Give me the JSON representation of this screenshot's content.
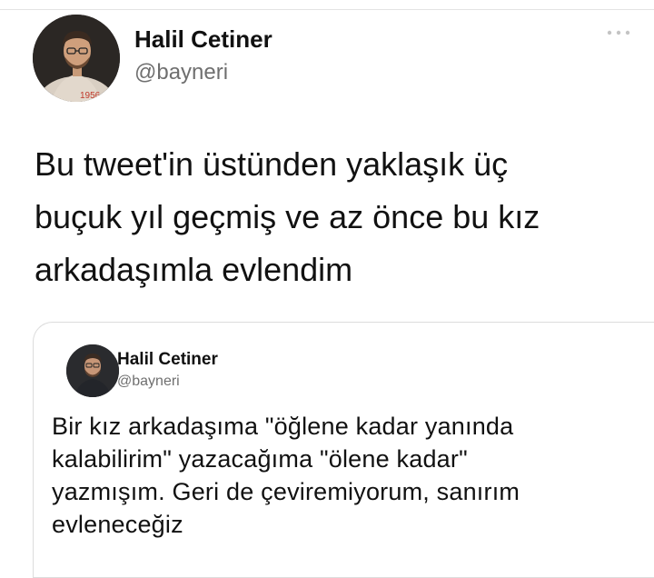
{
  "tweet": {
    "author": {
      "name": "Halil Cetiner",
      "handle": "@bayneri",
      "avatar_icon": "profile-avatar-photo"
    },
    "more_icon": "more-options-icon",
    "text": "Bu tweet'in üstünden yaklaşık üç\nbuçuk yıl geçmiş ve az önce bu kız\narkadaşımla evlendim"
  },
  "quoted_tweet": {
    "author": {
      "name": "Halil Cetiner",
      "handle": "@bayneri",
      "avatar_icon": "profile-avatar-photo"
    },
    "text": "Bir kız arkadaşıma \"öğlene kadar yanında\nkalabilirim\" yazacağıma \"ölene kadar\"\nyazmışım. Geri de çeviremiyorum, sanırım\nevleneceğiz"
  }
}
